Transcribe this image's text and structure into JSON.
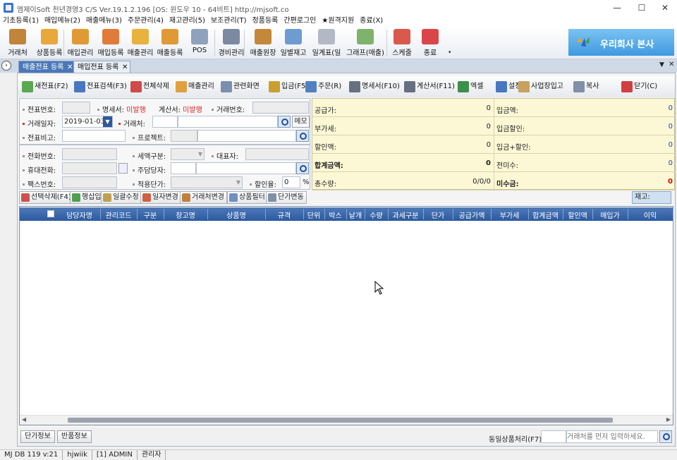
{
  "window": {
    "title": "엠제이Soft 천년경영3 C/S  Ver.19.1.2.196  [OS: 윈도우 10 - 64비트]  http://mjsoft.co"
  },
  "menu": [
    "기초등록(1)",
    "매입메뉴(2)",
    "매출메뉴(3)",
    "주문관리(4)",
    "재고관리(5)",
    "보조관리(T)",
    "정품등록",
    "간편로그인",
    "★원격지원",
    "종료(X)"
  ],
  "toolbar": [
    {
      "label": "거래처",
      "icon": "customer-icon",
      "color": "#c0843a"
    },
    {
      "label": "상품등록",
      "icon": "product-register-icon",
      "color": "#e8a83a"
    },
    {
      "label": "매입관리",
      "icon": "purchase-manage-icon",
      "color": "#e09a35"
    },
    {
      "label": "매입등록",
      "icon": "purchase-register-icon",
      "color": "#e07b3a"
    },
    {
      "label": "매출관리",
      "icon": "sales-manage-icon",
      "color": "#e7b23e"
    },
    {
      "label": "매출등록",
      "icon": "sales-register-icon",
      "color": "#e09a35"
    },
    {
      "label": "POS",
      "icon": "pos-icon",
      "color": "#8ea2bd"
    },
    {
      "label": "경비관리",
      "icon": "expense-icon",
      "color": "#7b8aa0"
    },
    {
      "label": "매출원장",
      "icon": "sales-ledger-icon",
      "color": "#c4883a"
    },
    {
      "label": "일별재고",
      "icon": "daily-stock-icon",
      "color": "#6f9bd1"
    },
    {
      "label": "일계표(일반)",
      "icon": "daily-report-icon",
      "color": "#b3b9c4"
    },
    {
      "label": "그래프(매출)",
      "icon": "graph-icon",
      "color": "#7db36a"
    },
    {
      "label": "스케줄",
      "icon": "calendar-icon",
      "color": "#d95a4a"
    },
    {
      "label": "종료",
      "icon": "exit-icon",
      "color": "#d9464a"
    }
  ],
  "company": {
    "name": "우리회사 본사"
  },
  "tabs": [
    {
      "label": "매출전표 등록",
      "active": true
    },
    {
      "label": "매입전표 등록",
      "active": false
    }
  ],
  "actions": [
    {
      "label": "새전표(F2)",
      "color": "#5aa850"
    },
    {
      "label": "전표검색(F3)",
      "color": "#4a78c0"
    },
    {
      "label": "전체삭제",
      "color": "#d04a4a"
    },
    {
      "label": "매출관리",
      "color": "#e0a040"
    },
    {
      "label": "관련화면",
      "color": "#7a8fb0"
    },
    {
      "label": "입금(F5)",
      "color": "#c8a030"
    },
    {
      "label": "주문(R)",
      "color": "#5080c0"
    },
    {
      "label": "명세서(F10)",
      "color": "#667080"
    },
    {
      "label": "계산서(F11)",
      "color": "#667080"
    },
    {
      "label": "엑셀",
      "color": "#3d8f4a"
    },
    {
      "label": "설정",
      "color": "#4a78c0"
    },
    {
      "label": "사업장입고",
      "color": "#c8a060"
    },
    {
      "label": "복사",
      "color": "#8090a8"
    },
    {
      "label": "닫기(C)",
      "color": "#d04040"
    }
  ],
  "form": {
    "slip_no_label": "전표번호:",
    "statement_label": "명세서:",
    "statement_value": "미발행",
    "invoice_label": "계산서:",
    "invoice_value": "미발행",
    "trade_no_label": "거래번호:",
    "trade_date_label": "거래일자:",
    "trade_date_value": "2019-01-03",
    "customer_label": "거래처:",
    "memo_button": "메모",
    "slip_note_label": "전표비고:",
    "project_label": "프로젝트:",
    "phone_label": "전화번호:",
    "tax_type_label": "세액구분:",
    "ceo_label": "대표자:",
    "mobile_label": "휴대전화:",
    "manager_label": "주담당자:",
    "fax_label": "팩스번호:",
    "apply_price_label": "적용단가:",
    "discount_rate_label": "할인율:",
    "discount_rate_value": "0",
    "percent": "%"
  },
  "summary": {
    "left": [
      {
        "label": "공급가:",
        "value": "0",
        "bold": false,
        "color": "normal"
      },
      {
        "label": "부가세:",
        "value": "0",
        "bold": false,
        "color": "normal"
      },
      {
        "label": "할인액:",
        "value": "0",
        "bold": false,
        "color": "normal"
      },
      {
        "label": "합계금액:",
        "value": "0",
        "bold": true,
        "color": "normal"
      },
      {
        "label": "총수량:",
        "value": "0/0/0",
        "bold": false,
        "color": "normal"
      }
    ],
    "right": [
      {
        "label": "입금액:",
        "value": "0",
        "bold": false,
        "color": "blue"
      },
      {
        "label": "입금할인:",
        "value": "0",
        "bold": false,
        "color": "blue"
      },
      {
        "label": "입금+할인:",
        "value": "0",
        "bold": false,
        "color": "blue"
      },
      {
        "label": "전미수:",
        "value": "0",
        "bold": false,
        "color": "blue"
      },
      {
        "label": "미수금:",
        "value": "0",
        "bold": true,
        "color": "red"
      }
    ]
  },
  "row_buttons": [
    {
      "label": "선택삭제(F4)",
      "color": "#d05050"
    },
    {
      "label": "행삽입",
      "color": "#50a050"
    },
    {
      "label": "일괄수정",
      "color": "#c0a050"
    },
    {
      "label": "일자변경",
      "color": "#d06040"
    },
    {
      "label": "거래처변경",
      "color": "#c08040"
    },
    {
      "label": "상품필터",
      "color": "#7090c0"
    },
    {
      "label": "단가변동",
      "color": "#8090a8"
    }
  ],
  "stock_label": "재고:",
  "grid_headers": [
    "담당자명",
    "관리코드",
    "구분",
    "창고명",
    "상품명",
    "규격",
    "단위",
    "박스",
    "낱개",
    "수량",
    "과세구분",
    "단가",
    "공급가액",
    "부가세",
    "합계금액",
    "할인액",
    "매입가",
    "이익"
  ],
  "bottom": {
    "price_info_button": "단가정보",
    "return_info_button": "반품정보",
    "same_product_label": "동일상품처리(F7):",
    "search_placeholder": "거래처를 먼저 입력하세요."
  },
  "status": [
    "MJ DB 119 v:21",
    "hjwiik",
    "[1] ADMIN",
    "관리자"
  ]
}
